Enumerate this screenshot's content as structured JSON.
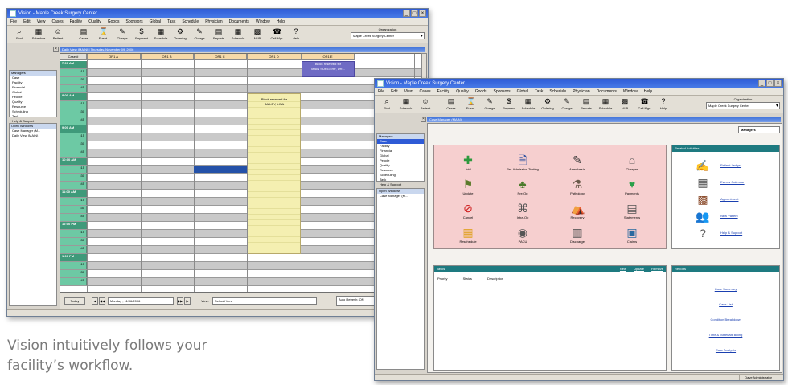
{
  "caption": {
    "line1": "Vision intuitively follows your",
    "line2": "facility’s workflow."
  },
  "window1": {
    "title": "Vision - Maple Creek Surgery Center",
    "menus": [
      "File",
      "Edit",
      "View",
      "Cases",
      "Facility",
      "Quality",
      "Goods",
      "Sponsors",
      "Global",
      "Task",
      "Schedule",
      "Physician",
      "Documents",
      "Window",
      "Help"
    ],
    "toolbar": [
      "Find",
      "Schedule",
      "Patient",
      "Cases",
      "Event",
      "Charge",
      "Payment",
      "Schedule",
      "Ordering",
      "Charge",
      "Reports",
      "Schedule",
      "NUB",
      "Call Mgr",
      "Help"
    ],
    "org_label": "Organization",
    "org_value": "Maple Creek Surgery Center",
    "view_title": "Daily View (MAIN) | Thursday, November 09, 2006",
    "left_header": "Managers",
    "left_items": [
      "Case",
      "Facility",
      "Financial",
      "Global",
      "People",
      "Quality",
      "Resource",
      "Scheduling",
      "Task",
      "Help & Support"
    ],
    "open_header": "Open Windows",
    "open_items": [
      "Case Manager (M...",
      "Daily View (MAIN)"
    ],
    "columns": [
      "Case #",
      "OR1 A",
      "OR1 B",
      "OR1 C",
      "OR1 D",
      "OR1 E"
    ],
    "times": [
      "7:00 AM",
      ":15",
      ":30",
      ":45",
      "8:00 AM",
      ":15",
      ":30",
      ":45",
      "9:00 AM",
      ":15",
      ":30",
      ":45",
      "10:00 AM",
      ":15",
      ":30",
      ":45",
      "11:00 AM",
      ":15",
      ":30",
      ":45",
      "12:00 PM",
      ":15",
      ":30",
      ":45",
      "1:00 PM",
      ":15",
      ":30",
      ":45"
    ],
    "block_reserved": "Block reserved for",
    "block_reserved_name": "BAILEY, LISA",
    "block_purple_1": "Block reserved for",
    "block_purple_2": "MAIN SURGERY, DR...",
    "today_button": "Today",
    "date_value": "Monday , 11/06/2006",
    "view_label": "View:",
    "view_value": "Default View",
    "autorefresh_label": "Auto Refresh: ON",
    "status_user": "Dave Administrator"
  },
  "window2": {
    "title": "Vision - Maple Creek Surgery Center",
    "menus": [
      "File",
      "Edit",
      "View",
      "Cases",
      "Facility",
      "Quality",
      "Goods",
      "Sponsors",
      "Global",
      "Task",
      "Schedule",
      "Physician",
      "Documents",
      "Window",
      "Help"
    ],
    "toolbar": [
      "Find",
      "Schedule",
      "Patient",
      "Cases",
      "Event",
      "Charge",
      "Payment",
      "Schedule",
      "Ordering",
      "Charge",
      "Reports",
      "Schedule",
      "NUB",
      "Call Mgr",
      "Help"
    ],
    "org_label": "Organization",
    "org_value": "Maple Creek Surgery Center",
    "view_title": "Case Manager (MAIN)",
    "manager_select": "Managers",
    "left_header": "Managers",
    "left_items": [
      "Case",
      "Facility",
      "Financial",
      "Global",
      "People",
      "Quality",
      "Resource",
      "Scheduling",
      "Task",
      "Help & Support"
    ],
    "open_header": "Open Windows",
    "open_items": [
      "Case Manager (M..."
    ],
    "case_icons": [
      {
        "label": "Add",
        "icon": "plus-icon"
      },
      {
        "label": "Pre-Admission Testing",
        "icon": "document-icon"
      },
      {
        "label": "Anesthesia",
        "icon": "syringe-icon"
      },
      {
        "label": "Charges",
        "icon": "cash-icon"
      },
      {
        "label": "Update",
        "icon": "update-icon"
      },
      {
        "label": "Pre-Op",
        "icon": "preop-icon"
      },
      {
        "label": "Pathology",
        "icon": "pathology-icon"
      },
      {
        "label": "Payments",
        "icon": "heart-icon"
      },
      {
        "label": "Cancel",
        "icon": "cancel-icon"
      },
      {
        "label": "Intra-Op",
        "icon": "intraop-icon"
      },
      {
        "label": "Recovery",
        "icon": "recovery-icon"
      },
      {
        "label": "Statements",
        "icon": "statements-icon"
      },
      {
        "label": "Reschedule",
        "icon": "reschedule-icon"
      },
      {
        "label": "PACU",
        "icon": "pacu-icon"
      },
      {
        "label": "Discharge",
        "icon": "discharge-icon"
      },
      {
        "label": "Claims",
        "icon": "claims-icon"
      }
    ],
    "related_title": "Related Activities",
    "related": [
      {
        "label": "Patient Ledger",
        "icon": "ledger-icon"
      },
      {
        "label": "Events Calendar",
        "icon": "calendar-icon"
      },
      {
        "label": "Appointment",
        "icon": "appointment-icon"
      },
      {
        "label": "New Patient",
        "icon": "people-icon"
      },
      {
        "label": "Help & Support",
        "icon": "help-icon"
      }
    ],
    "tasks_title": "Tasks",
    "tasks_actions": [
      "New",
      "Update",
      "Remove"
    ],
    "tasks_columns": [
      "Priority",
      "Status",
      "Description"
    ],
    "reports_title": "Reports",
    "reports": [
      "Case Summary",
      "Case List",
      "Condition Breakdown",
      "Time & Materials Billing",
      "Case Analysis"
    ],
    "status_user": "Dave Administrator"
  }
}
